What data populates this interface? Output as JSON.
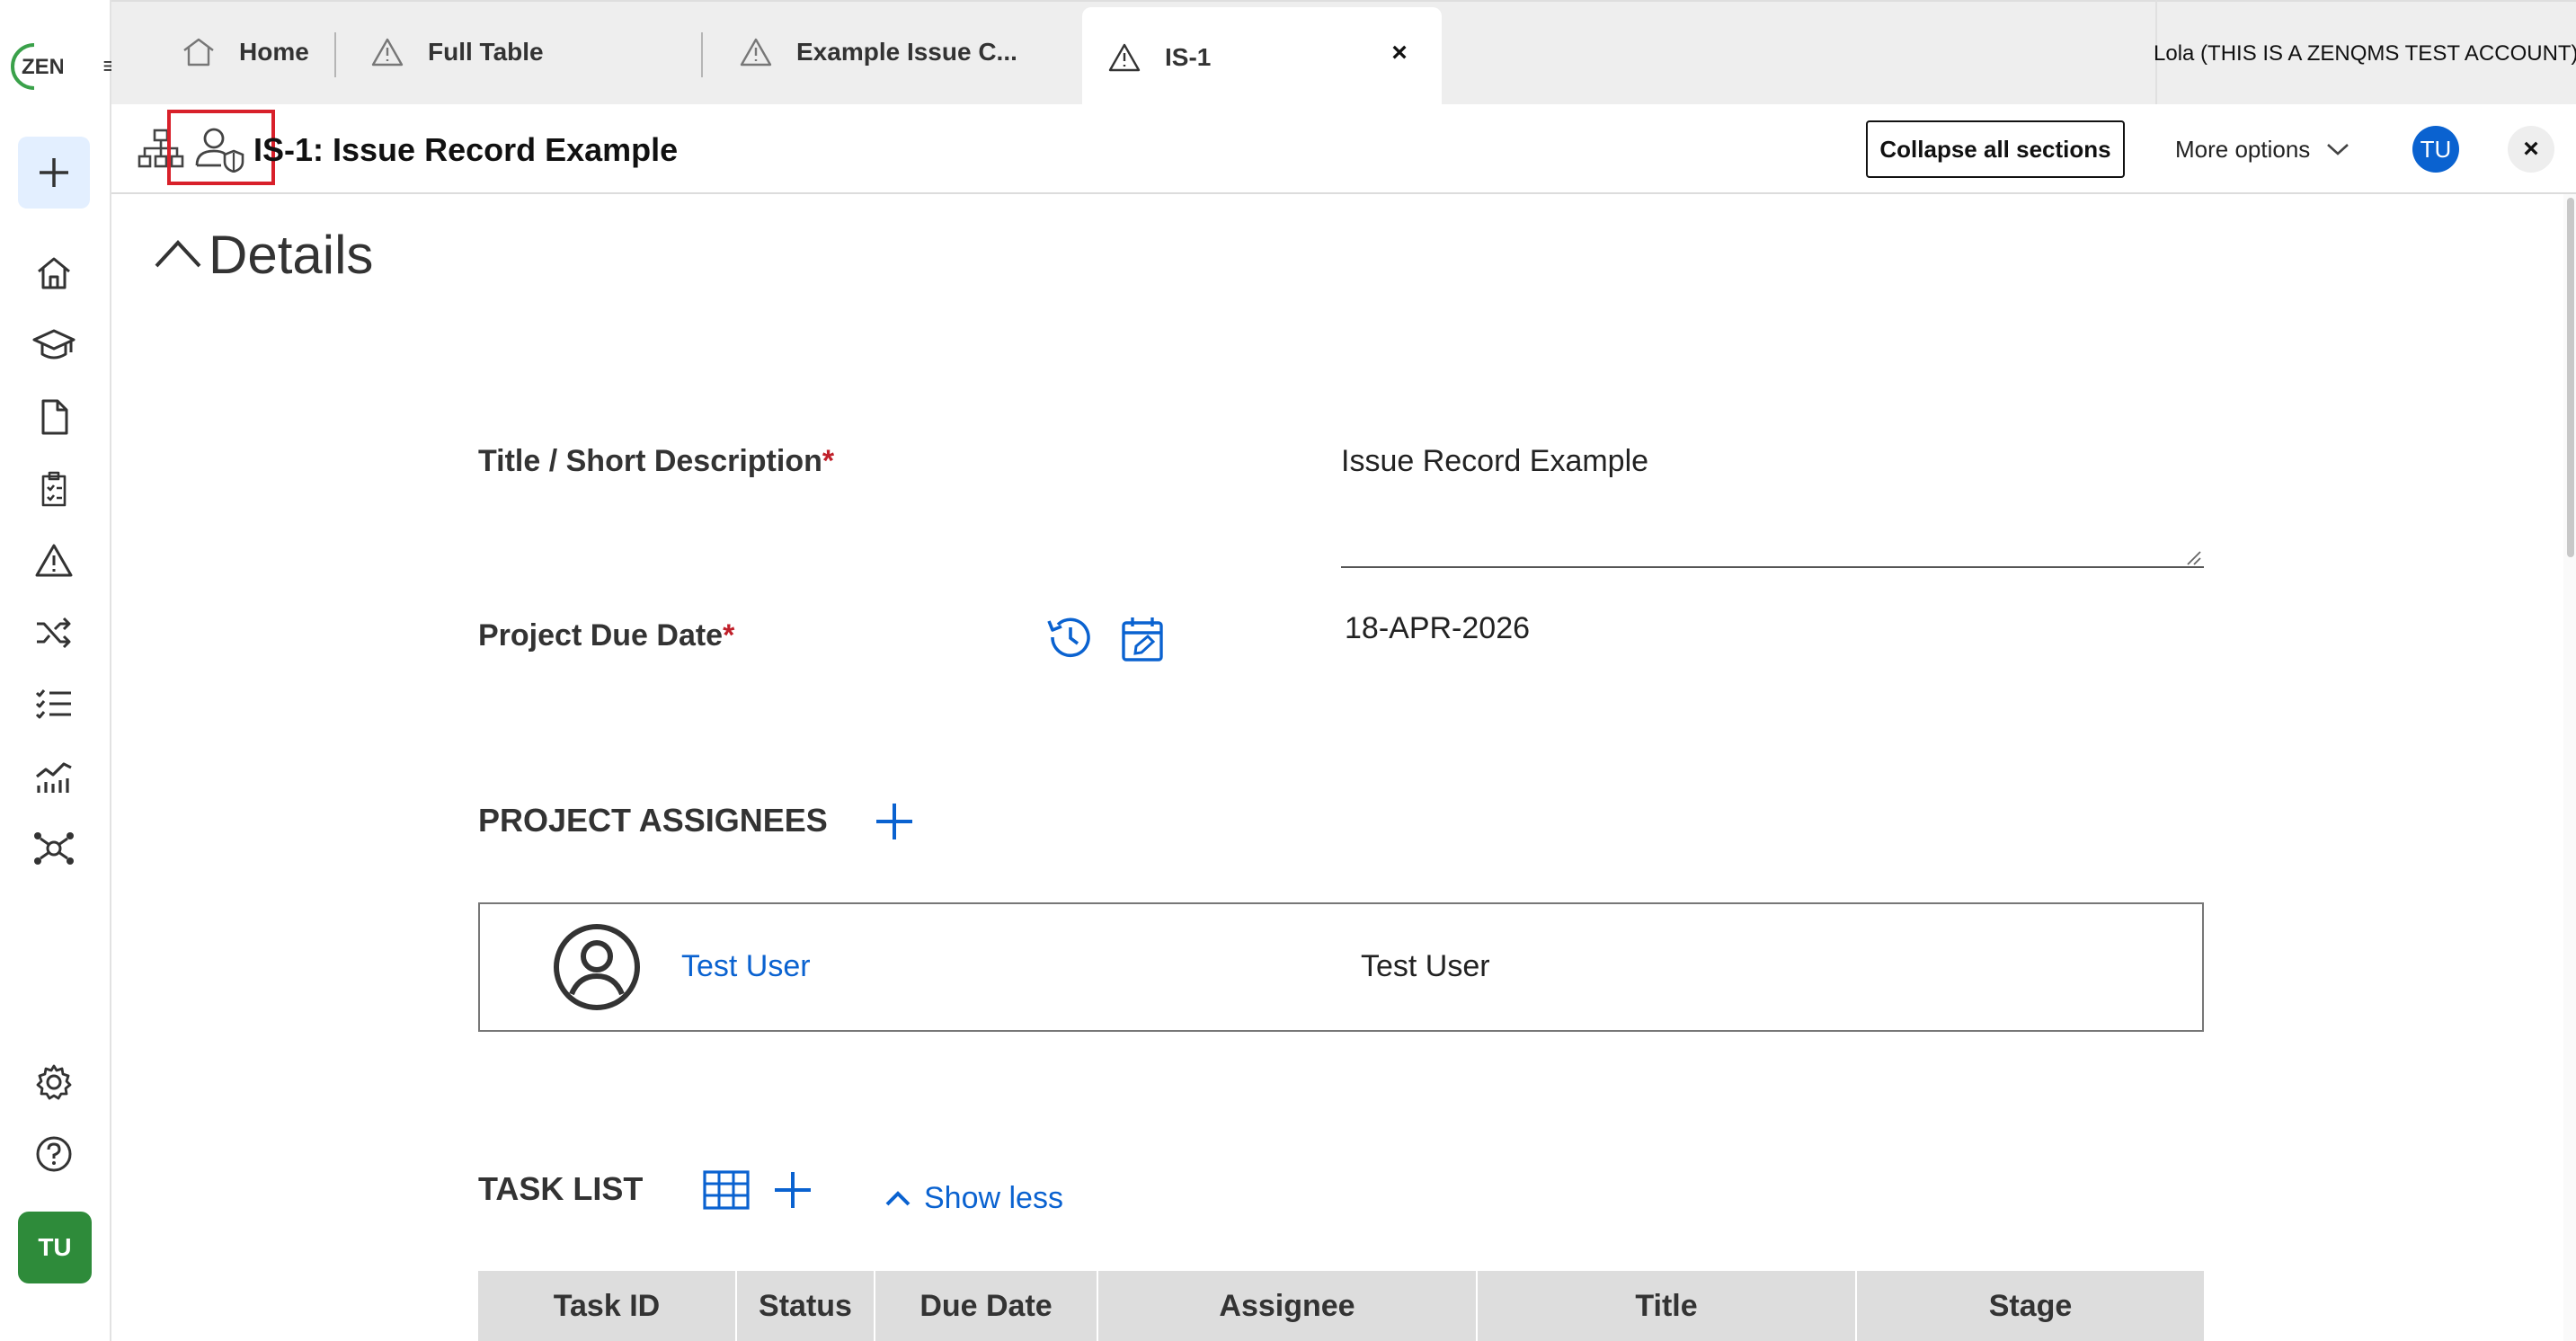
{
  "app": {
    "logo_text": "ZEN"
  },
  "tabs": [
    {
      "label": "Home",
      "icon": "home-icon"
    },
    {
      "label": "Full Table",
      "icon": "warning-icon"
    },
    {
      "label": "Example Issue C...",
      "icon": "warning-icon"
    },
    {
      "label": "IS-1",
      "icon": "warning-icon",
      "active": true,
      "close": "×"
    }
  ],
  "account": {
    "label": "Lola (THIS IS A ZENQMS TEST ACCOUNT)"
  },
  "sidebar": {
    "items": [
      {
        "name": "home",
        "icon": "home-icon"
      },
      {
        "name": "training",
        "icon": "graduation-cap-icon"
      },
      {
        "name": "documents",
        "icon": "document-icon"
      },
      {
        "name": "checklists",
        "icon": "clipboard-icon"
      },
      {
        "name": "issues",
        "icon": "warning-icon"
      },
      {
        "name": "changes",
        "icon": "shuffle-icon"
      },
      {
        "name": "lists",
        "icon": "checklist-icon"
      },
      {
        "name": "reports",
        "icon": "chart-icon"
      },
      {
        "name": "network",
        "icon": "network-icon"
      }
    ],
    "bottom": [
      {
        "name": "settings",
        "icon": "gear-icon"
      },
      {
        "name": "help",
        "icon": "help-icon"
      }
    ],
    "user_initials": "TU"
  },
  "header": {
    "title": "IS-1: Issue Record Example",
    "collapse_label": "Collapse all sections",
    "more_options_label": "More options",
    "avatar_initials": "TU",
    "close": "×"
  },
  "details": {
    "section_title": "Details",
    "title_label": "Title / Short Description",
    "title_value": "Issue Record Example",
    "due_label": "Project Due Date",
    "due_value": "18-APR-2026",
    "required_mark": "*"
  },
  "assignees": {
    "heading": "PROJECT ASSIGNEES",
    "rows": [
      {
        "link": "Test User",
        "name": "Test User"
      }
    ]
  },
  "tasks": {
    "heading": "TASK LIST",
    "show_less": "Show less",
    "columns": [
      "Task ID",
      "Status",
      "Due Date",
      "Assignee",
      "Title",
      "Stage"
    ]
  },
  "colors": {
    "accent": "#0a62d0",
    "brand_green": "#2e8b3a",
    "highlight": "#d8202a",
    "required": "#c0202a"
  }
}
